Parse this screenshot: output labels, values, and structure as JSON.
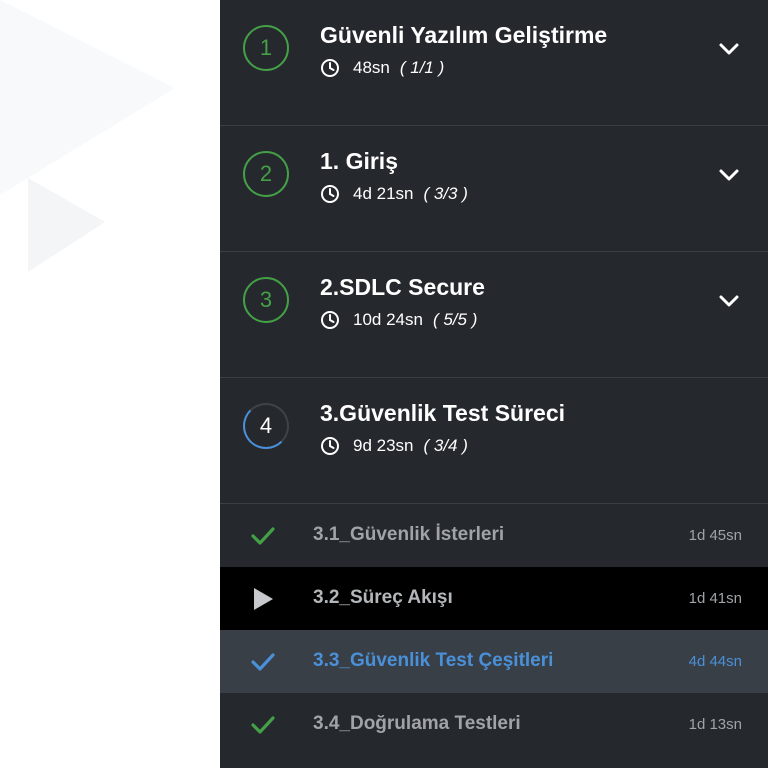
{
  "colors": {
    "panel_bg": "#25282c",
    "complete_green": "#43a047",
    "accent_blue": "#4a90d9",
    "text_white": "#ffffff",
    "text_muted": "#a0a3a7"
  },
  "sections": [
    {
      "number": "1",
      "title": "Güvenli Yazılım Geliştirme",
      "duration": "48sn",
      "progress": "( 1/1 )",
      "state": "complete",
      "icon": "chevron-down-icon"
    },
    {
      "number": "2",
      "title": "1. Giriş",
      "duration": "4d 21sn",
      "progress": "( 3/3 )",
      "state": "complete",
      "icon": "chevron-down-icon"
    },
    {
      "number": "3",
      "title": "2.SDLC Secure",
      "duration": "10d 24sn",
      "progress": "( 5/5 )",
      "state": "complete",
      "icon": "chevron-down-icon"
    },
    {
      "number": "4",
      "title": "3.Güvenlik Test Süreci",
      "duration": "9d 23sn",
      "progress": "( 3/4 )",
      "state": "in-progress"
    }
  ],
  "lessons": [
    {
      "title": "3.1_Güvenlik İsterleri",
      "duration": "1d 45sn",
      "state": "complete",
      "icon": "check-icon"
    },
    {
      "title": "3.2_Süreç Akışı",
      "duration": "1d 41sn",
      "state": "playing",
      "icon": "play-icon"
    },
    {
      "title": "3.3_Güvenlik Test Çeşitleri",
      "duration": "4d 44sn",
      "state": "selected",
      "icon": "check-icon"
    },
    {
      "title": "3.4_Doğrulama Testleri",
      "duration": "1d 13sn",
      "state": "complete",
      "icon": "check-icon"
    }
  ]
}
